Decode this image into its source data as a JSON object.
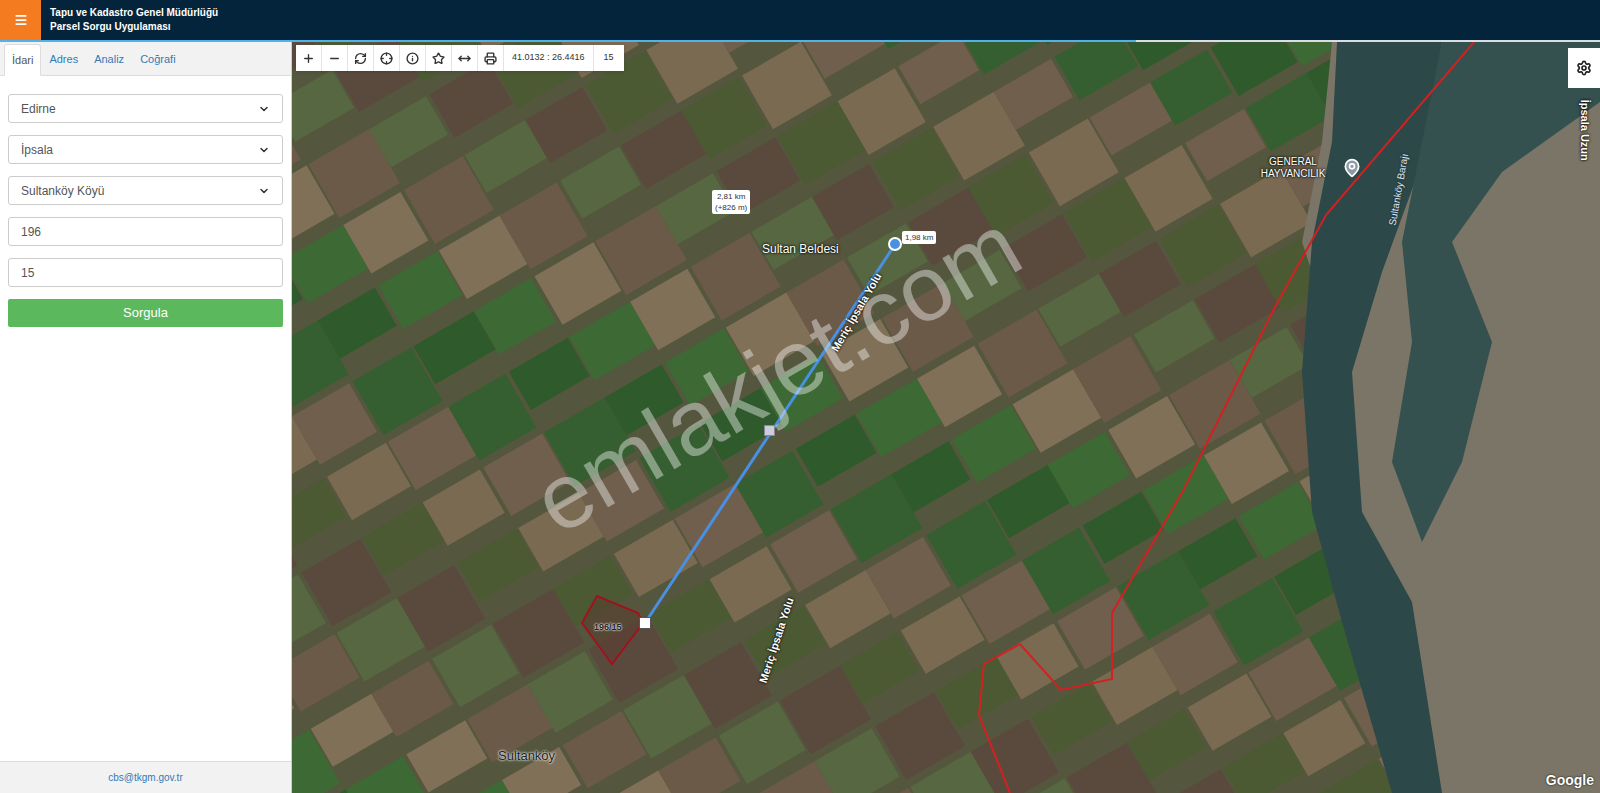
{
  "header": {
    "title": "Tapu ve Kadastro Genel Müdürlüğü",
    "subtitle": "Parsel Sorgu Uygulaması"
  },
  "loading_bar": {
    "level": 0.71
  },
  "tabs": [
    {
      "label": "İdari",
      "selected": true
    },
    {
      "label": "Adres",
      "selected": false
    },
    {
      "label": "Analiz",
      "selected": false
    },
    {
      "label": "Coğrafi",
      "selected": false
    }
  ],
  "fields": [
    {
      "kind": "select",
      "value": "Edirne"
    },
    {
      "kind": "select",
      "value": "İpsala"
    },
    {
      "kind": "select",
      "value": "Sultanköy Köyü"
    },
    {
      "kind": "input",
      "value": "196"
    },
    {
      "kind": "input",
      "value": "15"
    }
  ],
  "query_button": "Sorgula",
  "footer": "cbs@tkgm.gov.tr",
  "map": {
    "toolbar": {
      "coordinates": "41.0132 : 26.4416",
      "zoom": "15"
    },
    "labels": [
      {
        "text": "Sultan Beldesi",
        "kind": "place"
      },
      {
        "text": "Meriç İpsala Yolu",
        "kind": "road"
      },
      {
        "text": "Meriç İpsala Yolu",
        "kind": "road"
      },
      {
        "text": "Sultanköy Barajı",
        "kind": "water"
      },
      {
        "text": "İpsala Uzun",
        "kind": "road"
      },
      {
        "text": "Sultanköy",
        "kind": "town"
      }
    ],
    "poi": "GENERAL HAYVANCILIK",
    "parcel_label": "196/15",
    "measure": {
      "total": "2,81 km",
      "extra": "(+826 m)",
      "segment": "1,98 km"
    },
    "watermark": "emlakjet.com",
    "attribution": "Google"
  }
}
